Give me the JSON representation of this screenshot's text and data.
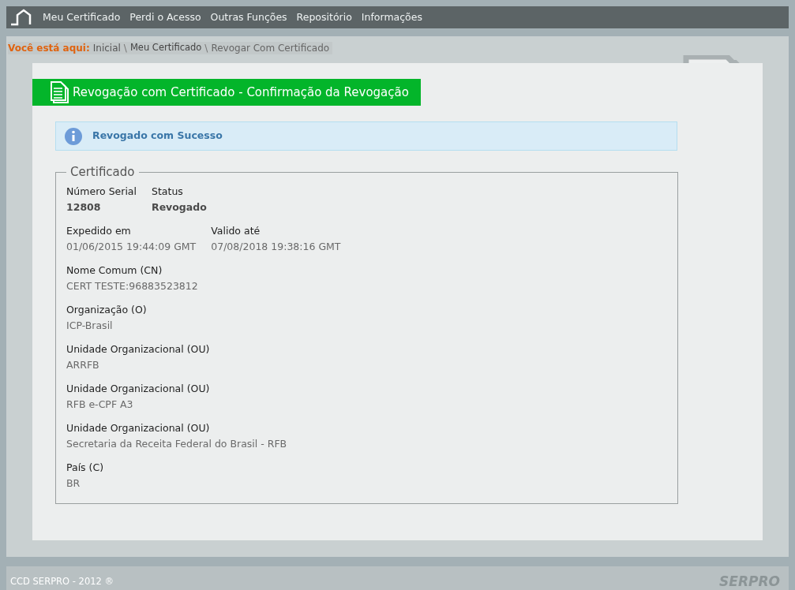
{
  "nav": {
    "items": [
      "Meu Certificado",
      "Perdi o Acesso",
      "Outras Funções",
      "Repositório",
      "Informações"
    ]
  },
  "breadcrumb": {
    "label": "Você está aqui:",
    "items": [
      {
        "text": "Inicial",
        "separator": "\\"
      },
      {
        "text": "Meu Certificado",
        "separator": "\\"
      },
      {
        "text": "Revogar Com Certificado"
      }
    ]
  },
  "page_title": "Revogação com Certificado - Confirmação da Revogação",
  "message": "Revogado com Sucesso",
  "certificate": {
    "legend": "Certificado",
    "groups": [
      {
        "fields": [
          {
            "label": "Número Serial",
            "value": "12808",
            "kind": "bold"
          },
          {
            "label": "Status",
            "value": "Revogado",
            "kind": "bold"
          }
        ]
      },
      {
        "fields": [
          {
            "label": "Expedido em",
            "value": "01/06/2015 19:44:09 GMT",
            "kind": "plain"
          },
          {
            "label": "Valido até",
            "value": "07/08/2018 19:38:16 GMT",
            "kind": "plain"
          }
        ]
      },
      {
        "fields": [
          {
            "label": "Nome Comum (CN)",
            "value": "CERT TESTE:96883523812",
            "kind": "plain"
          }
        ]
      },
      {
        "fields": [
          {
            "label": "Organização (O)",
            "value": "ICP-Brasil",
            "kind": "plain"
          }
        ]
      },
      {
        "fields": [
          {
            "label": "Unidade Organizacional (OU)",
            "value": "ARRFB",
            "kind": "plain"
          }
        ]
      },
      {
        "fields": [
          {
            "label": "Unidade Organizacional (OU)",
            "value": "RFB e-CPF A3",
            "kind": "plain"
          }
        ]
      },
      {
        "fields": [
          {
            "label": "Unidade Organizacional (OU)",
            "value": "Secretaria da Receita Federal do Brasil - RFB",
            "kind": "plain"
          }
        ]
      },
      {
        "fields": [
          {
            "label": "País (C)",
            "value": "BR",
            "kind": "plain"
          }
        ]
      }
    ]
  },
  "footer": {
    "copyright": "CCD SERPRO - 2012 ®",
    "logo": "SERPRO"
  }
}
